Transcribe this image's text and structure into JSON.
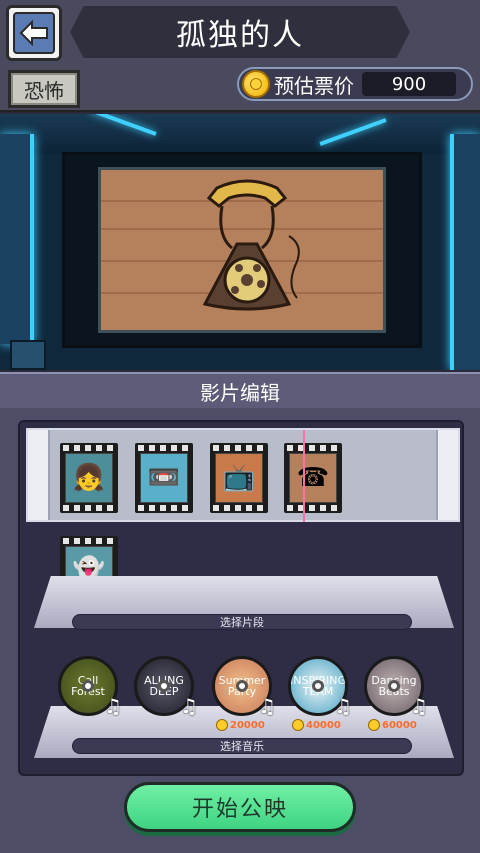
{
  "header": {
    "title": "孤独的人",
    "genre": "恐怖",
    "price_label": "预估票价",
    "price_value": "900"
  },
  "editor": {
    "title": "影片编辑",
    "clip_shelf_label": "选择片段",
    "music_shelf_label": "选择音乐"
  },
  "music": [
    {
      "name": "Call Forest",
      "cost": ""
    },
    {
      "name": "ALLING DEEP",
      "cost": ""
    },
    {
      "name": "Summer Party",
      "cost": "20000"
    },
    {
      "name": "INSPIRING TEAM",
      "cost": "40000"
    },
    {
      "name": "Dancing Beats",
      "cost": "60000"
    }
  ],
  "actions": {
    "start_label": "开始公映"
  },
  "colors": {
    "accent_green": "#3fd382",
    "neon_blue": "#3fd0ff",
    "playhead": "#ff6fa8"
  }
}
